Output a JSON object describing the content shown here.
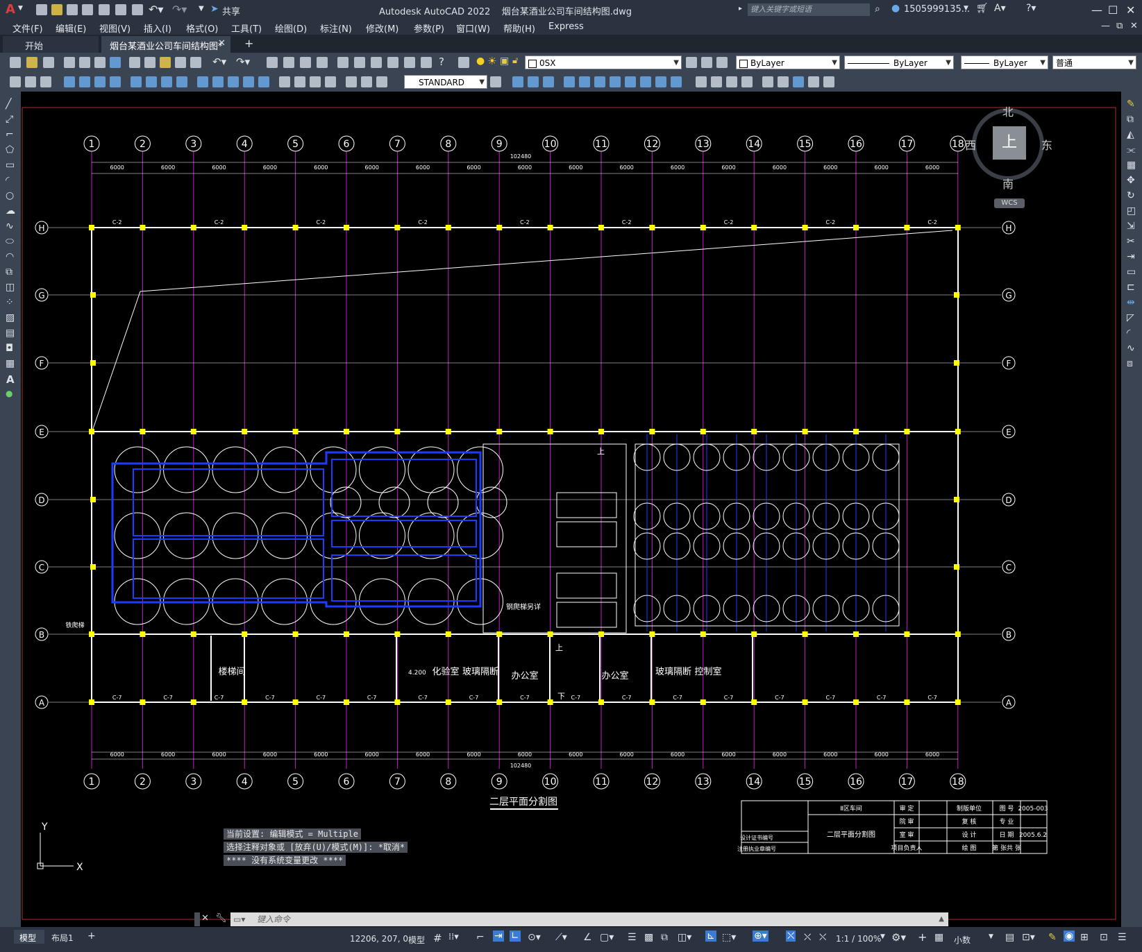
{
  "app": {
    "title": "Autodesk AutoCAD 2022",
    "file": "烟台某酒业公司车间结构图.dwg",
    "share": "共享",
    "search_placeholder": "键入关键字或短语",
    "user": "1505999135...",
    "logo": "A"
  },
  "menu": [
    "文件(F)",
    "编辑(E)",
    "视图(V)",
    "插入(I)",
    "格式(O)",
    "工具(T)",
    "绘图(D)",
    "标注(N)",
    "修改(M)",
    "参数(P)",
    "窗口(W)",
    "帮助(H)",
    "Express"
  ],
  "tabs": {
    "start": "开始",
    "active": "烟台某酒业公司车间结构图*",
    "add": "+"
  },
  "toolbar": {
    "layer": "0SX",
    "color": "ByLayer",
    "linetype": "ByLayer",
    "lineweight": "ByLayer",
    "plotstyle": "普通",
    "textstyle": "STANDARD"
  },
  "navcube": {
    "north": "北",
    "south": "南",
    "east": "东",
    "west": "西",
    "top": "上",
    "wcs": "WCS"
  },
  "drawing": {
    "axes_top": [
      "1",
      "2",
      "3",
      "4",
      "5",
      "6",
      "7",
      "8",
      "9",
      "10",
      "11",
      "12",
      "13",
      "14",
      "15",
      "16",
      "17",
      "18"
    ],
    "axes_side": [
      "H",
      "G",
      "F",
      "E",
      "D",
      "C",
      "B",
      "A"
    ],
    "total_dim": "102480",
    "bay_dim": "6000",
    "rooms": [
      "楼梯间",
      "化验室",
      "玻璃隔断",
      "办公室",
      "办公室",
      "玻璃隔断",
      "控制室"
    ],
    "stair_note": "钢爬梯另详",
    "stair_left": "铁爬梯",
    "window_tag": "C-2",
    "window_tag_low": "C-7",
    "up": "上",
    "down": "下",
    "drawing_title": "二层平面分割图",
    "level": "4.200",
    "title_block": {
      "area": "Ⅱ区车间",
      "r1": [
        "审 定",
        "制版单位",
        "图 号",
        "2005-003"
      ],
      "r2": [
        "院 审",
        "复 核",
        "专 业"
      ],
      "r3": [
        "室 审",
        "设 计",
        "日 期",
        "2005.6.2"
      ],
      "r4": [
        "项目负责人",
        "绘 图",
        "第 张共 张"
      ],
      "name": "二层平面分割图",
      "l1": "设计证书编号",
      "l2": "注册执业章编号"
    }
  },
  "command": {
    "h1": "当前设置: 编辑模式 = Multiple",
    "h2": "选择注释对象或 [放弃(U)/模式(M)]: *取消*",
    "h3": "**** 没有系统变量更改 ****",
    "placeholder": "键入命令"
  },
  "status": {
    "model_tab": "模型",
    "layout_tab": "布局1",
    "coords": "12206, 207, 0",
    "mode": "模型",
    "scale": "1:1 / 100%",
    "units": "小数"
  },
  "ucs": {
    "x": "X",
    "y": "Y"
  }
}
